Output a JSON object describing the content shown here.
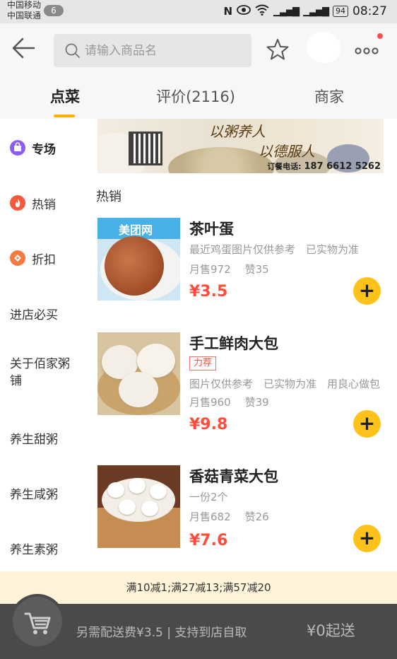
{
  "status_bar": {
    "carrier1": "中国移动",
    "carrier2": "中国联通",
    "badge": "6",
    "battery": "94",
    "time": "08:27"
  },
  "header": {
    "search_placeholder": "请输入商品名"
  },
  "tabs": [
    {
      "label": "点菜",
      "active": true
    },
    {
      "label": "评价(2116)",
      "active": false
    },
    {
      "label": "商家",
      "active": false
    }
  ],
  "sidebar": {
    "items": [
      {
        "label": "专场",
        "icon": "bag-icon",
        "color": "#8b5cf6"
      },
      {
        "label": "热销",
        "icon": "fire-icon",
        "color": "#f5593d"
      },
      {
        "label": "折扣",
        "icon": "discount-icon",
        "color": "#f57a3d"
      },
      {
        "label": "进店必买"
      },
      {
        "label": "关于佰家粥铺"
      },
      {
        "label": "养生甜粥"
      },
      {
        "label": "养生咸粥"
      },
      {
        "label": "养生素粥"
      }
    ]
  },
  "banner": {
    "slogan1": "以粥养人",
    "slogan2": "以德服人",
    "phone_label": "订餐电话:",
    "phone_number": "187 6612 5262"
  },
  "section_title": "热销",
  "products": [
    {
      "name": "茶叶蛋",
      "desc": "最近鸡蛋图片仅供参考　已实物为准",
      "monthly_sales": "月售972",
      "likes": "赞35",
      "price": "¥3.5",
      "photo_watermark": "美团网"
    },
    {
      "name": "手工鲜肉大包",
      "tag": "力荐",
      "desc": "图片仅供参考　已实物为准　用良心做包子",
      "monthly_sales": "月售960",
      "likes": "赞39",
      "price": "¥9.8"
    },
    {
      "name": "香菇青菜大包",
      "desc": "一份2个",
      "monthly_sales": "月售682",
      "likes": "赞26",
      "price": "¥7.6"
    }
  ],
  "add_label": "+",
  "promo": "满10减1;满27减13;满57减20",
  "bottom": {
    "delivery_note": "另需配送费¥3.5 | 支持到店自取",
    "min_order": "¥0起送"
  },
  "colors": {
    "accent": "#ffb000",
    "price": "#ff4c3b",
    "add_button": "#ffc21a"
  }
}
